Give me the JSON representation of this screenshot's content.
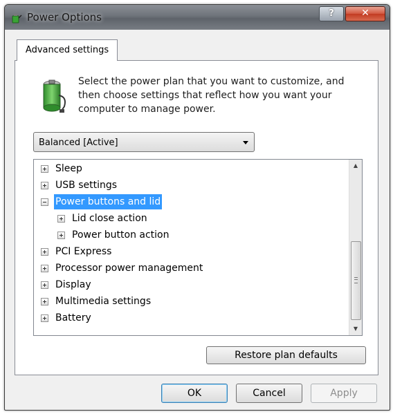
{
  "window": {
    "title": "Power Options"
  },
  "titlebar": {
    "help_label": "?",
    "close_label": "✕"
  },
  "tab": {
    "label": "Advanced settings"
  },
  "description": "Select the power plan that you want to customize, and then choose settings that reflect how you want your computer to manage power.",
  "plan_select": {
    "value": "Balanced [Active]"
  },
  "tree": {
    "items": [
      {
        "label": "Sleep",
        "expander": "plus",
        "level": 0,
        "selected": false
      },
      {
        "label": "USB settings",
        "expander": "plus",
        "level": 0,
        "selected": false
      },
      {
        "label": "Power buttons and lid",
        "expander": "minus",
        "level": 0,
        "selected": true
      },
      {
        "label": "Lid close action",
        "expander": "plus",
        "level": 1,
        "selected": false
      },
      {
        "label": "Power button action",
        "expander": "plus",
        "level": 1,
        "selected": false
      },
      {
        "label": "PCI Express",
        "expander": "plus",
        "level": 0,
        "selected": false
      },
      {
        "label": "Processor power management",
        "expander": "plus",
        "level": 0,
        "selected": false
      },
      {
        "label": "Display",
        "expander": "plus",
        "level": 0,
        "selected": false
      },
      {
        "label": "Multimedia settings",
        "expander": "plus",
        "level": 0,
        "selected": false
      },
      {
        "label": "Battery",
        "expander": "plus",
        "level": 0,
        "selected": false
      }
    ]
  },
  "buttons": {
    "restore": "Restore plan defaults",
    "ok": "OK",
    "cancel": "Cancel",
    "apply": "Apply"
  },
  "colors": {
    "selection": "#3399ff",
    "close_button": "#c23b22",
    "battery_green": "#3aa335"
  }
}
